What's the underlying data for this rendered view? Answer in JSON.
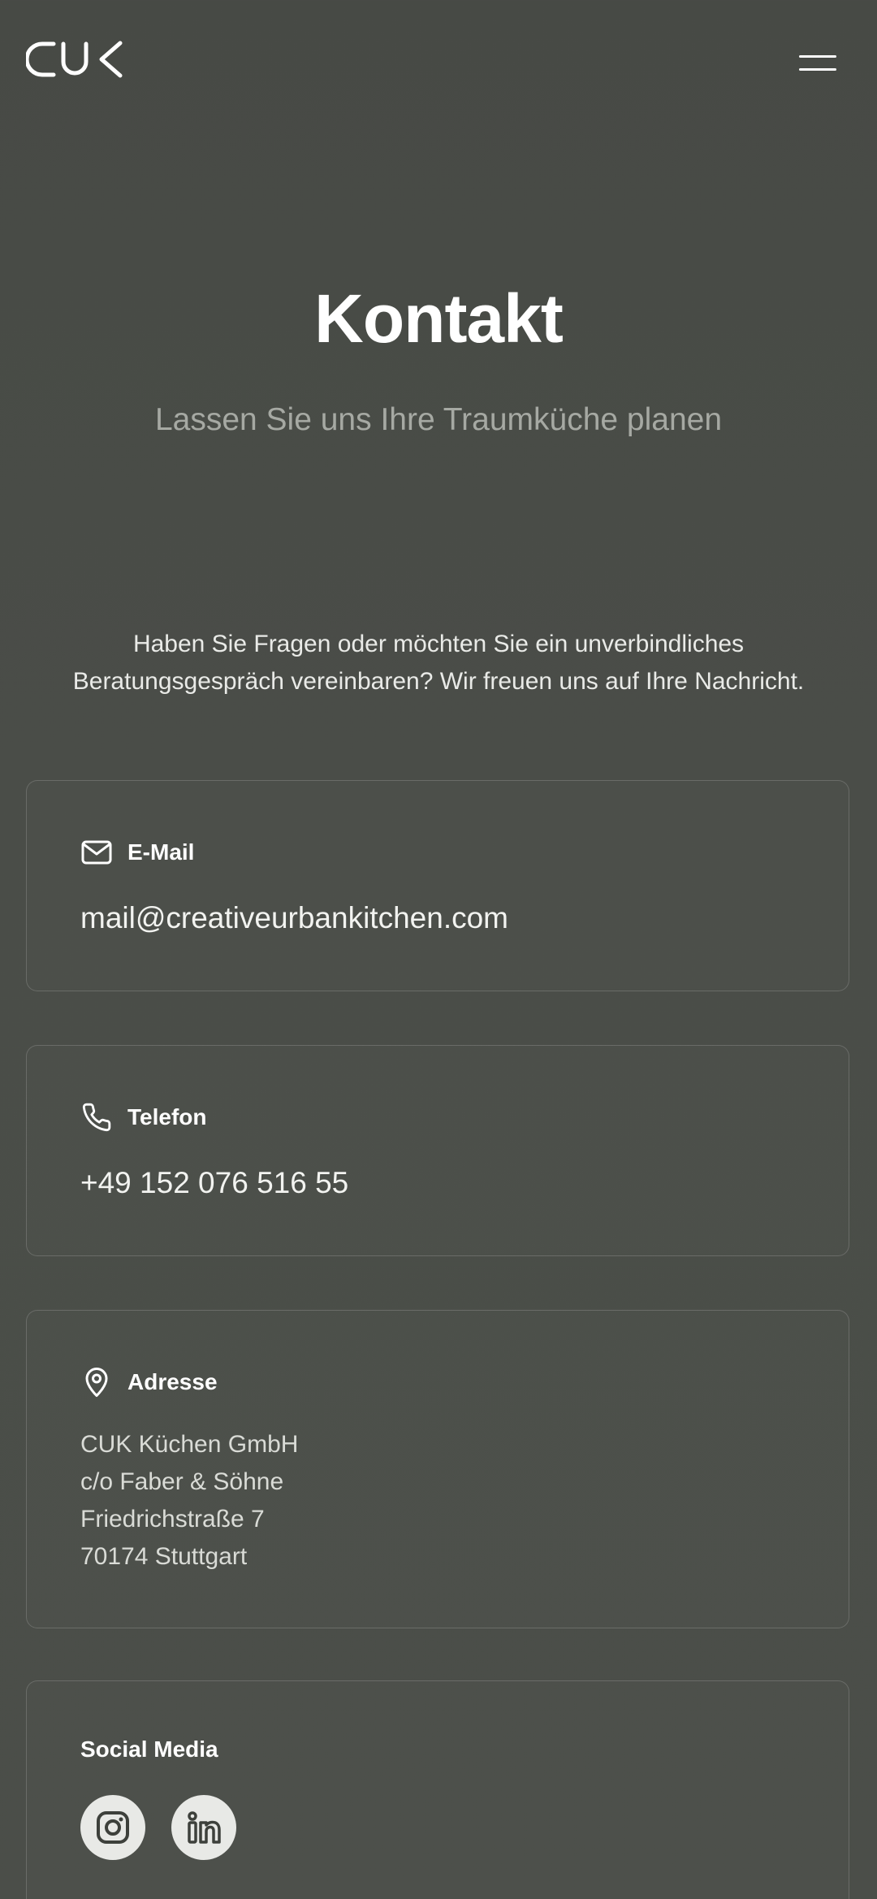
{
  "header": {
    "logo_alt": "CUK",
    "menu_icon": "hamburger-icon"
  },
  "hero": {
    "title": "Kontakt",
    "subtitle": "Lassen Sie uns Ihre Traumküche planen"
  },
  "intro": {
    "line1": "Haben Sie Fragen oder möchten Sie ein unverbindliches",
    "line2": "Beratungsgespräch vereinbaren? Wir freuen uns auf Ihre Nachricht."
  },
  "email": {
    "icon": "mail-icon",
    "label": "E-Mail",
    "value": "mail@creativeurbankitchen.com"
  },
  "phone": {
    "icon": "phone-icon",
    "label": "Telefon",
    "value": "+49 152 076 516 55"
  },
  "address": {
    "icon": "map-pin-icon",
    "label": "Adresse",
    "lines": [
      "CUK Küchen GmbH",
      "c/o Faber & Söhne",
      "Friedrichstraße 7",
      "70174 Stuttgart"
    ]
  },
  "social": {
    "label": "Social Media",
    "items": [
      {
        "icon": "instagram-icon",
        "name": "Instagram"
      },
      {
        "icon": "linkedin-icon",
        "name": "LinkedIn"
      }
    ]
  },
  "colors": {
    "background": "#484b46",
    "text": "#ffffff",
    "muted": "#a6a9a3",
    "social_bg": "#e8e9e6"
  }
}
